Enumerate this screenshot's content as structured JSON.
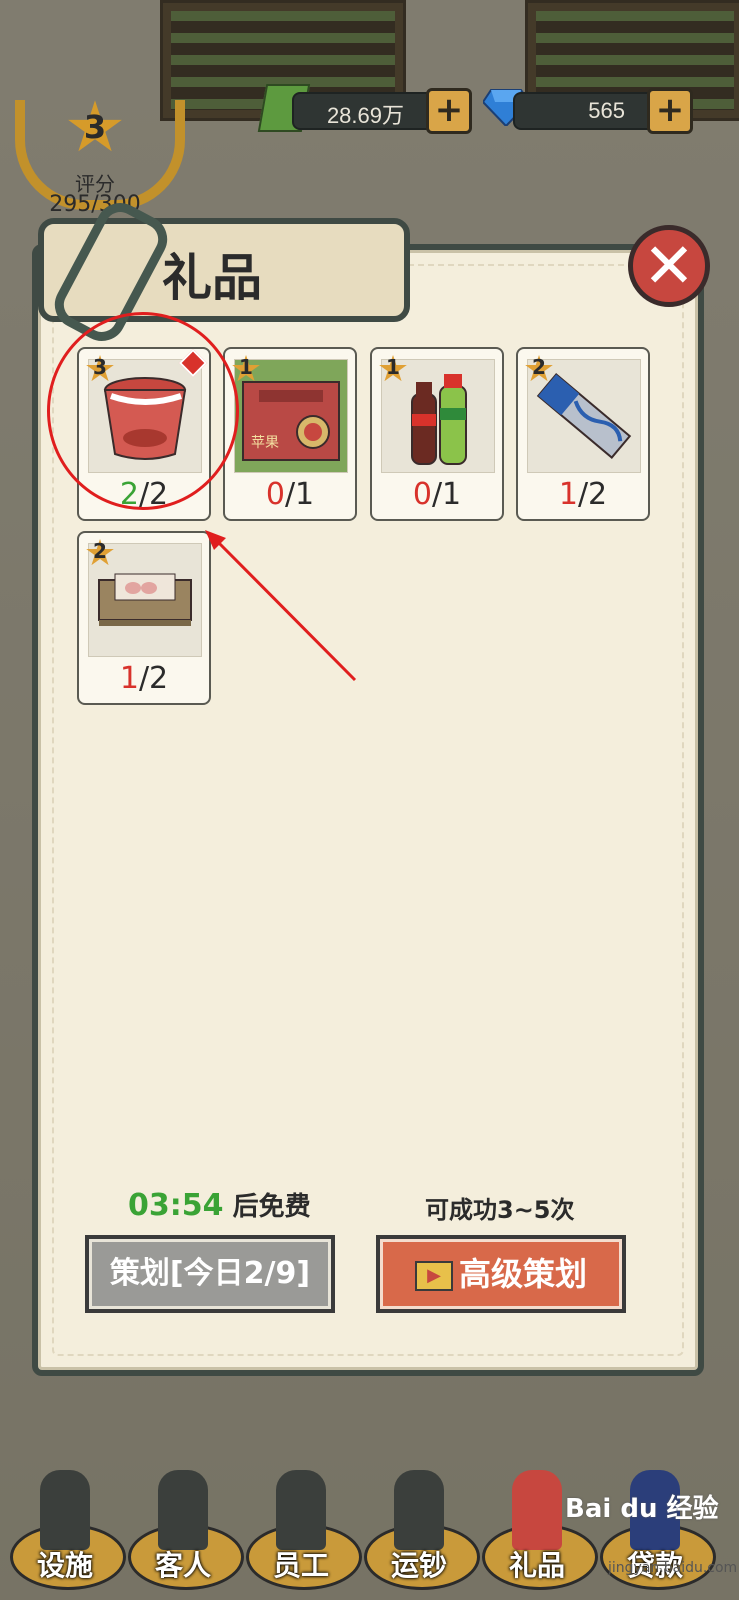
{
  "hud": {
    "score_level": "3",
    "score_label": "评分",
    "score_value": "295/300",
    "money": "28.69万",
    "gems": "565"
  },
  "panel": {
    "title": "礼品",
    "close_symbol": "✕"
  },
  "gifts": [
    {
      "name": "instant-noodles",
      "stars": "3",
      "have": "2",
      "total": "/2",
      "have_color": "#3aa335",
      "has_dot": true
    },
    {
      "name": "apple-box",
      "stars": "1",
      "have": "0",
      "total": "/1",
      "have_color": "#d8322b",
      "label": "苹果"
    },
    {
      "name": "soda-bottles",
      "stars": "1",
      "have": "0",
      "total": "/1",
      "have_color": "#d8322b"
    },
    {
      "name": "snack-bar",
      "stars": "2",
      "have": "1",
      "total": "/2",
      "have_color": "#d8322b"
    },
    {
      "name": "egg-tray",
      "stars": "2",
      "have": "1",
      "total": "/2",
      "have_color": "#d8322b"
    }
  ],
  "footer": {
    "timer": "03:54",
    "timer_suffix": "后免费",
    "chance": "可成功3~5次",
    "plan_button": "策划[今日2/9]",
    "advanced_button": "高级策划"
  },
  "bottom_nav": [
    {
      "label": "设施"
    },
    {
      "label": "客人"
    },
    {
      "label": "员工"
    },
    {
      "label": "运钞"
    },
    {
      "label": "礼品"
    },
    {
      "label": "贷款"
    }
  ],
  "watermark": {
    "brand": "Bai du 经验",
    "url": "jingyan.baidu.com"
  },
  "colors": {
    "panel_bg": "#f4eedc",
    "panel_border": "#3f4a44",
    "accent_red": "#d8322b",
    "accent_green": "#3aa335",
    "advanced_button": "#d8694a"
  }
}
